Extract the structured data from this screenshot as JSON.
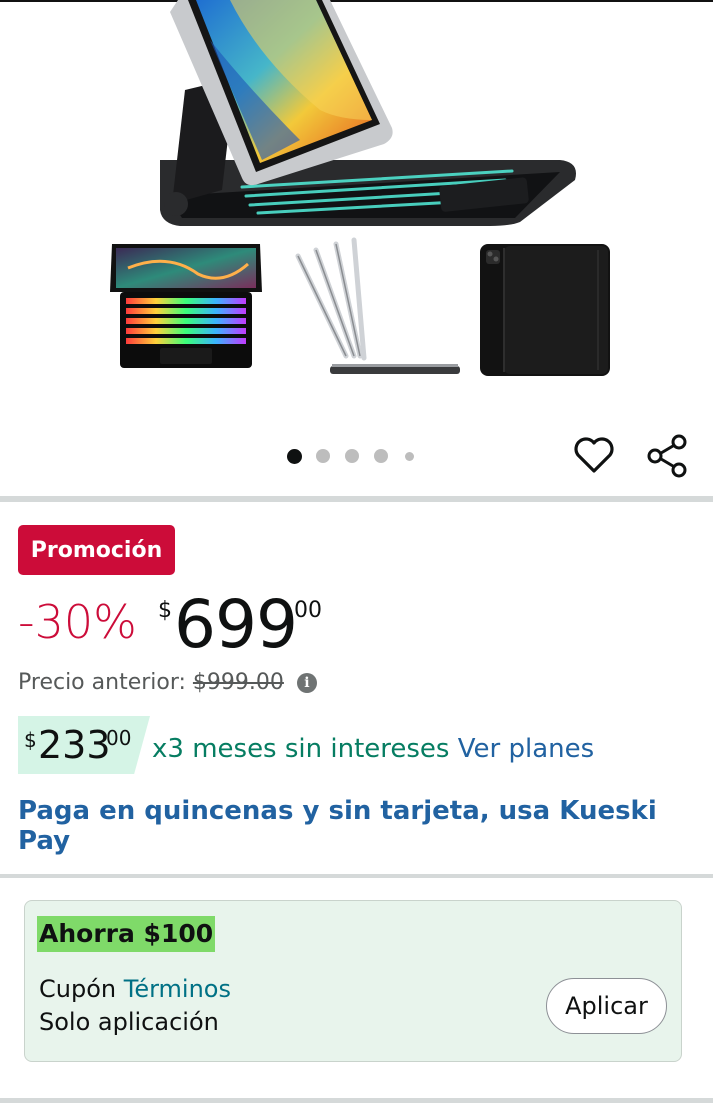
{
  "gallery": {
    "image_alt": "Funda con teclado retroiluminado para iPad",
    "slide_count": 5,
    "active_slide": 1
  },
  "promo": {
    "badge": "Promoción"
  },
  "price": {
    "discount": "-30%",
    "currency_symbol": "$",
    "whole": "699",
    "fraction": "00",
    "previous_label": "Precio anterior:",
    "previous_value": "$999.00",
    "info_glyph": "i"
  },
  "installments": {
    "currency_symbol": "$",
    "whole": "233",
    "fraction": "00",
    "text": "x3 meses sin intereses",
    "link": "Ver planes"
  },
  "kueski": {
    "text": "Paga en quincenas y sin tarjeta, usa Kueski Pay"
  },
  "coupon": {
    "save_label": "Ahorra $100",
    "coupon_word": "Cupón",
    "terms_link": "Términos",
    "app_only": "Solo aplicación",
    "apply_button": "Aplicar"
  },
  "icons": {
    "favorite": "heart-icon",
    "share": "share-icon",
    "info": "info-icon"
  },
  "colors": {
    "promo_red": "#cc0c39",
    "link_blue": "#2162a1",
    "msi_green": "#067d62",
    "coupon_bg": "#e8f4ec",
    "save_highlight": "#7fda69"
  }
}
